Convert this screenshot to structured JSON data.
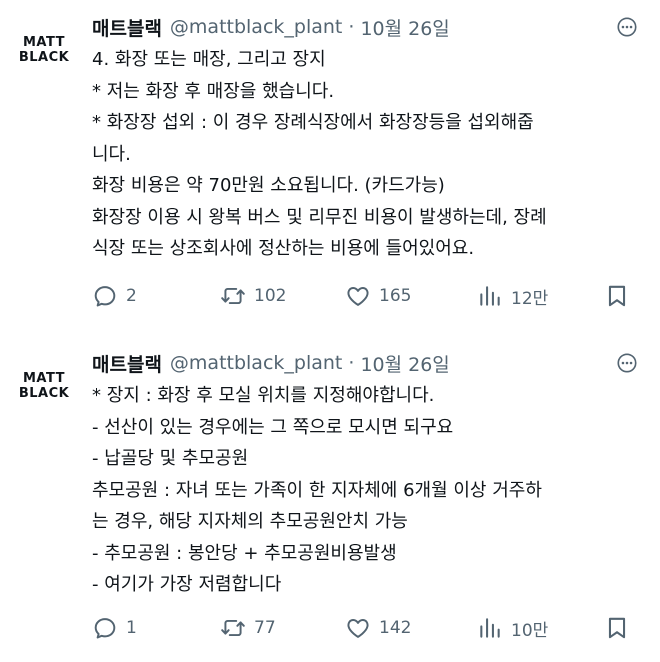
{
  "tweets": [
    {
      "avatar": {
        "line1": "MATT",
        "line2": "BLACK"
      },
      "name": "매트블랙",
      "handle": "@mattblack_plant",
      "separator": "·",
      "date": "10월 26일",
      "body_lines": [
        "4. 화장 또는 매장, 그리고 장지",
        "* 저는 화장 후 매장을 했습니다.",
        "* 화장장 섭외 : 이 경우 장례식장에서 화장장등을 섭외해줍",
        "니다.",
        "화장 비용은 약 70만원 소요됩니다. (카드가능)",
        "화장장 이용 시 왕복 버스 및 리무진 비용이 발생하는데, 장례",
        "식장 또는 상조회사에 정산하는 비용에 들어있어요."
      ],
      "stats": {
        "replies": "2",
        "retweets": "102",
        "likes": "165",
        "views": "12만"
      }
    },
    {
      "avatar": {
        "line1": "MATT",
        "line2": "BLACK"
      },
      "name": "매트블랙",
      "handle": "@mattblack_plant",
      "separator": "·",
      "date": "10월 26일",
      "body_lines": [
        "* 장지 : 화장 후 모실 위치를 지정해야합니다.",
        "- 선산이 있는 경우에는 그 쪽으로 모시면 되구요",
        "- 납골당 및 추모공원",
        "추모공원 : 자녀 또는 가족이 한 지자체에 6개월 이상 거주하",
        "는 경우, 해당 지자체의 추모공원안치 가능",
        "- 추모공원 : 봉안당 + 추모공원비용발생",
        "- 여기가 가장 저렴합니다"
      ],
      "stats": {
        "replies": "1",
        "retweets": "77",
        "likes": "142",
        "views": "10만"
      }
    }
  ],
  "icons": {
    "reply": "reply-icon",
    "retweet": "retweet-icon",
    "like": "heart-icon",
    "views": "views-chart-icon",
    "bookmark": "bookmark-icon",
    "more": "more-options-icon"
  },
  "colors": {
    "text": "#0f1419",
    "secondary": "#536471",
    "background": "#ffffff"
  }
}
